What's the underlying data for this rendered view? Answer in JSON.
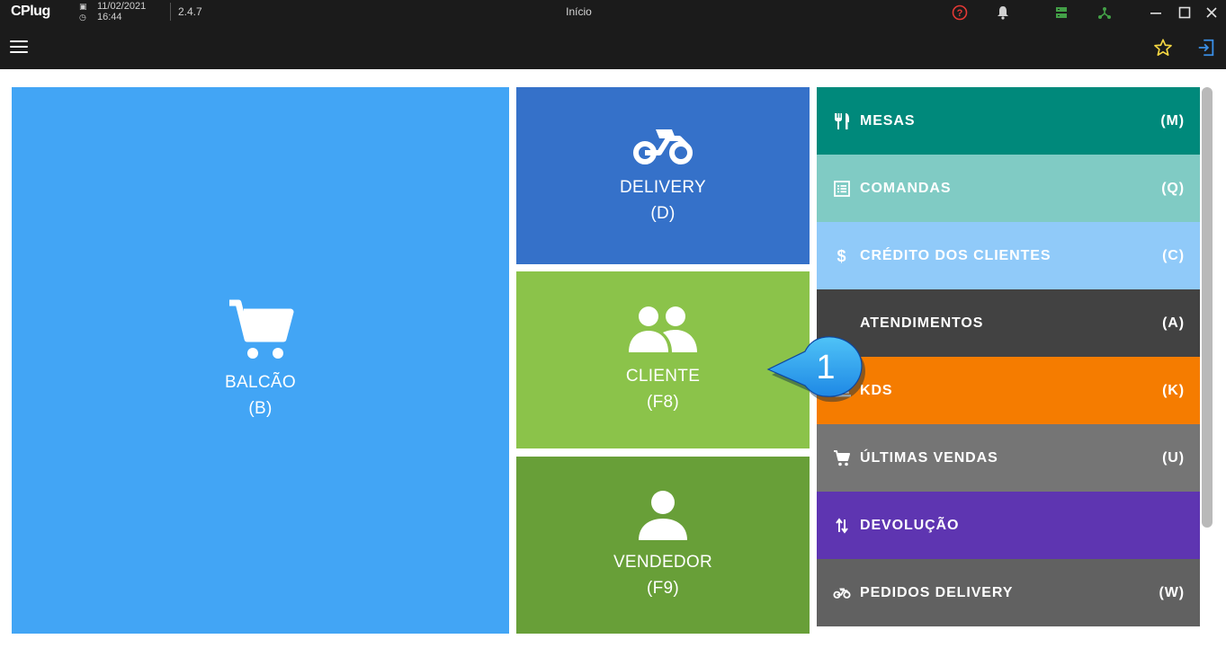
{
  "titlebar": {
    "logo": "CPlug",
    "date": "11/02/2021",
    "time": "16:44",
    "version": "2.4.7",
    "title": "Início"
  },
  "colors": {
    "bar": "#1b1b1b",
    "balcao": "#42a5f5",
    "delivery": "#3571c9",
    "cliente": "#8bc34a",
    "vendedor": "#689f38",
    "star": "#f5d742",
    "exit": "#3a8ee6"
  },
  "tiles": {
    "balcao": {
      "label": "BALCÃO",
      "key": "(B)",
      "icon": "cart-icon"
    },
    "delivery": {
      "label": "DELIVERY",
      "key": "(D)",
      "icon": "motorcycle-icon"
    },
    "cliente": {
      "label": "CLIENTE",
      "key": "(F8)",
      "icon": "people-icon"
    },
    "vendedor": {
      "label": "VENDEDOR",
      "key": "(F9)",
      "icon": "person-icon"
    }
  },
  "menu": [
    {
      "label": "MESAS",
      "key": "(M)",
      "icon": "utensils-icon",
      "color": "#00897b"
    },
    {
      "label": "COMANDAS",
      "key": "(Q)",
      "icon": "list-icon",
      "color": "#80cbc4"
    },
    {
      "label": "CRÉDITO DOS CLIENTES",
      "key": "(C)",
      "icon": "dollar-icon",
      "color": "#90caf9"
    },
    {
      "label": "ATENDIMENTOS",
      "key": "(A)",
      "icon": "clipboard-icon",
      "color": "#424242"
    },
    {
      "label": "KDS",
      "key": "(K)",
      "icon": "cloche-icon",
      "color": "#f57c00"
    },
    {
      "label": "ÚLTIMAS VENDAS",
      "key": "(U)",
      "icon": "cart-icon",
      "color": "#757575"
    },
    {
      "label": "DEVOLUÇÃO",
      "key": "",
      "icon": "swap-vertical-icon",
      "color": "#5e35b1"
    },
    {
      "label": "PEDIDOS DELIVERY",
      "key": "(W)",
      "icon": "motorcycle-icon",
      "color": "#616161"
    }
  ],
  "callout": {
    "number": "1"
  }
}
